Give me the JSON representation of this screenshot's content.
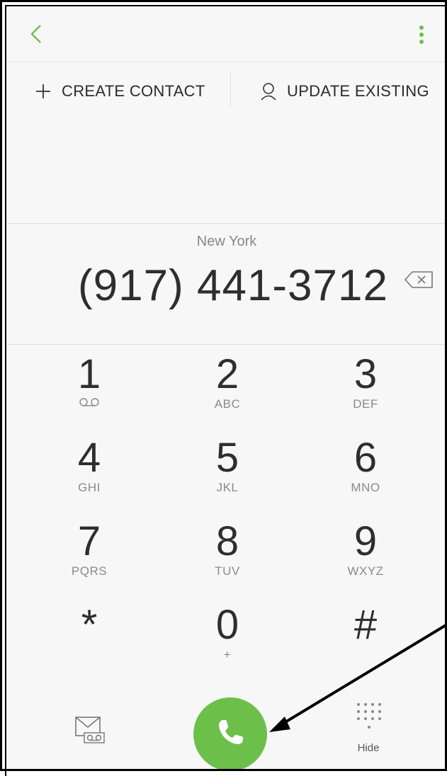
{
  "header": {
    "back_icon": "chevron-left-icon",
    "more_icon": "more-vertical-icon"
  },
  "actions": {
    "create_contact": "CREATE CONTACT",
    "update_existing": "UPDATE EXISTING"
  },
  "dialer": {
    "location": "New York",
    "number": "(917) 441-3712"
  },
  "keypad": {
    "keys": [
      {
        "digit": "1",
        "letters": "",
        "icon": "voicemail-icon"
      },
      {
        "digit": "2",
        "letters": "ABC"
      },
      {
        "digit": "3",
        "letters": "DEF"
      },
      {
        "digit": "4",
        "letters": "GHI"
      },
      {
        "digit": "5",
        "letters": "JKL"
      },
      {
        "digit": "6",
        "letters": "MNO"
      },
      {
        "digit": "7",
        "letters": "PQRS"
      },
      {
        "digit": "8",
        "letters": "TUV"
      },
      {
        "digit": "9",
        "letters": "WXYZ"
      },
      {
        "digit": "*",
        "letters": ""
      },
      {
        "digit": "0",
        "letters": "+"
      },
      {
        "digit": "#",
        "letters": ""
      }
    ]
  },
  "bottom": {
    "hide_label": "Hide",
    "call_icon": "phone-icon",
    "voicemail_icon": "voicemail-message-icon",
    "keypad_icon": "keypad-dots-icon"
  },
  "colors": {
    "accent": "#6cc04a",
    "background": "#f7f7f7",
    "text": "#2e2e2e",
    "muted": "#888888"
  }
}
